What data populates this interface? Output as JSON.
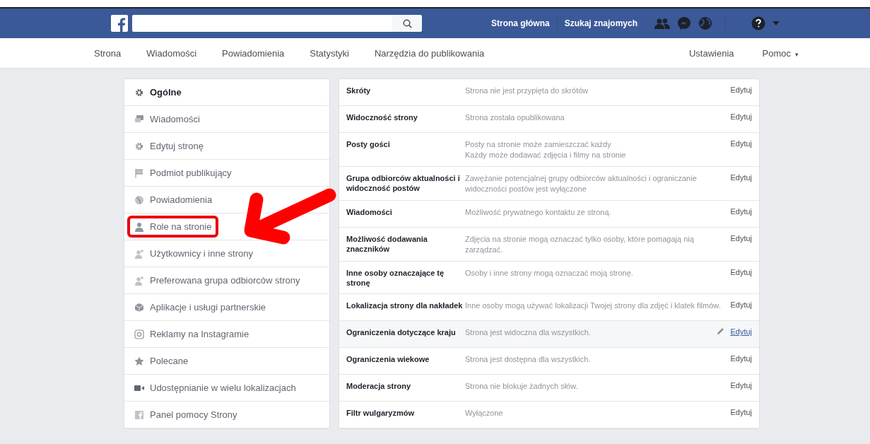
{
  "top_bar": {
    "links": [
      "Strona główna",
      "Szukaj znajomych"
    ]
  },
  "page_nav": {
    "left": [
      "Strona",
      "Wiadomości",
      "Powiadomienia",
      "Statystyki",
      "Narzędzia do publikowania"
    ],
    "right": [
      {
        "label": "Ustawienia"
      },
      {
        "label": "Pomoc",
        "caret": "▾"
      }
    ]
  },
  "sidebar": {
    "items": [
      {
        "label": "Ogólne",
        "selected": true,
        "highlighted": false
      },
      {
        "label": "Wiadomości",
        "selected": false,
        "highlighted": false
      },
      {
        "label": "Edytuj stronę",
        "selected": false,
        "highlighted": false
      },
      {
        "label": "Podmiot publikujący",
        "selected": false,
        "highlighted": false
      },
      {
        "label": "Powiadomienia",
        "selected": false,
        "highlighted": false
      },
      {
        "label": "Role na stronie",
        "selected": false,
        "highlighted": true
      },
      {
        "label": "Użytkownicy i inne strony",
        "selected": false,
        "highlighted": false
      },
      {
        "label": "Preferowana grupa odbiorców strony",
        "selected": false,
        "highlighted": false
      },
      {
        "label": "Aplikacje i usługi partnerskie",
        "selected": false,
        "highlighted": false
      },
      {
        "label": "Reklamy na Instagramie",
        "selected": false,
        "highlighted": false
      },
      {
        "label": "Polecane",
        "selected": false,
        "highlighted": false
      },
      {
        "label": "Udostępnianie w wielu lokalizacjach",
        "selected": false,
        "highlighted": false
      },
      {
        "label": "Panel pomocy Strony",
        "selected": false,
        "highlighted": false
      }
    ]
  },
  "settings": {
    "rows": [
      {
        "name": "Skróty",
        "value": [
          "Strona nie jest przypięta do skrótów"
        ],
        "action": "Edytuj",
        "hovered": false
      },
      {
        "name": "Widoczność strony",
        "value": [
          "Strona została opublikowana"
        ],
        "action": "Edytuj",
        "hovered": false
      },
      {
        "name": "Posty gości",
        "value": [
          "Posty na stronie może zamieszczać każdy",
          "Każdy może dodawać zdjęcia i filmy na stronie"
        ],
        "action": "Edytuj",
        "hovered": false
      },
      {
        "name": "Grupa odbiorców aktualności i widoczność postów",
        "value": [
          "Zawężanie potencjalnej grupy odbiorców aktualności i ograniczanie widoczności postów jest wyłączone"
        ],
        "action": "Edytuj",
        "hovered": false
      },
      {
        "name": "Wiadomości",
        "value": [
          "Możliwość prywatnego kontaktu ze stroną."
        ],
        "action": "Edytuj",
        "hovered": false
      },
      {
        "name": "Możliwość dodawania znaczników",
        "value": [
          "Zdjęcia na stronie mogą oznaczać tylko osoby, które pomagają nią zarządzać."
        ],
        "action": "Edytuj",
        "hovered": false
      },
      {
        "name": "Inne osoby oznaczające tę stronę",
        "value": [
          "Osoby i inne strony mogą oznaczać moją stronę."
        ],
        "action": "Edytuj",
        "hovered": false
      },
      {
        "name": "Lokalizacja strony dla nakładek",
        "value": [
          "Inne osoby mogą używać lokalizacji Twojej strony dla zdjęć i klatek filmów."
        ],
        "action": "Edytuj",
        "hovered": false
      },
      {
        "name": "Ograniczenia dotyczące kraju",
        "value": [
          "Strona jest widoczna dla wszystkich."
        ],
        "action": "Edytuj",
        "hovered": true
      },
      {
        "name": "Ograniczenia wiekowe",
        "value": [
          "Strona jest dostępna dla wszystkich."
        ],
        "action": "Edytuj",
        "hovered": false
      },
      {
        "name": "Moderacja strony",
        "value": [
          "Strona nie blokuje żadnych słów."
        ],
        "action": "Edytuj",
        "hovered": false
      },
      {
        "name": "Filtr wulgaryzmów",
        "value": [
          "Wyłączone"
        ],
        "action": "Edytuj",
        "hovered": false
      }
    ]
  }
}
